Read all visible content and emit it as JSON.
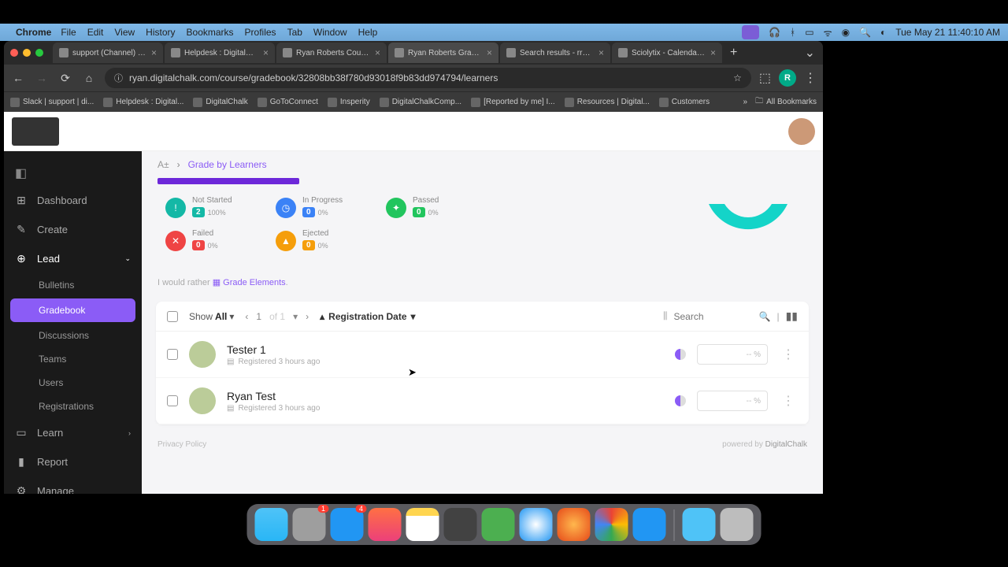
{
  "menubar": {
    "app": "Chrome",
    "items": [
      "File",
      "Edit",
      "View",
      "History",
      "Bookmarks",
      "Profiles",
      "Tab",
      "Window",
      "Help"
    ],
    "clock": "Tue May 21  11:40:10 AM"
  },
  "tabs": [
    {
      "title": "support (Channel) - di..."
    },
    {
      "title": "Helpdesk : DigitalChalk"
    },
    {
      "title": "Ryan Roberts Courses"
    },
    {
      "title": "Ryan Roberts Gradebo...",
      "active": true
    },
    {
      "title": "Search results - rrober..."
    },
    {
      "title": "Sciolytix - Calendar - W..."
    }
  ],
  "url": "ryan.digitalchalk.com/course/gradebook/32808bb38f780d93018f9b83dd974794/learners",
  "avatar_letter": "R",
  "bookmarks": [
    "Slack | support | di...",
    "Helpdesk : Digital...",
    "DigitalChalk",
    "GoToConnect",
    "Insperity",
    "DigitalChalkComp...",
    "[Reported by me] I...",
    "Resources | Digital...",
    "Customers"
  ],
  "bm_all": "All Bookmarks",
  "sidebar": {
    "items": [
      {
        "label": "Dashboard",
        "icon": "⊞"
      },
      {
        "label": "Create",
        "icon": "✎"
      },
      {
        "label": "Lead",
        "icon": "⊕",
        "expanded": true
      },
      {
        "label": "Learn",
        "icon": "▭"
      },
      {
        "label": "Report",
        "icon": "▮"
      },
      {
        "label": "Manage",
        "icon": "⚙"
      }
    ],
    "sub": [
      {
        "label": "Bulletins"
      },
      {
        "label": "Gradebook",
        "active": true
      },
      {
        "label": "Discussions"
      },
      {
        "label": "Teams"
      },
      {
        "label": "Users"
      },
      {
        "label": "Registrations"
      }
    ]
  },
  "breadcrumb": {
    "link": "Grade by Learners"
  },
  "stats": [
    {
      "label": "Not Started",
      "count": "2",
      "pct": "100%",
      "badge_bg": "#14b8a6",
      "icon_bg": "#14b8a6",
      "icon": "!"
    },
    {
      "label": "In Progress",
      "count": "0",
      "pct": "0%",
      "badge_bg": "#3b82f6",
      "icon_bg": "#3b82f6",
      "icon": "◷"
    },
    {
      "label": "Passed",
      "count": "0",
      "pct": "0%",
      "badge_bg": "#22c55e",
      "icon_bg": "#22c55e",
      "icon": "✦"
    },
    {
      "label": "Failed",
      "count": "0",
      "pct": "0%",
      "badge_bg": "#ef4444",
      "icon_bg": "#ef4444",
      "icon": "✕"
    },
    {
      "label": "Ejected",
      "count": "0",
      "pct": "0%",
      "badge_bg": "#f59e0b",
      "icon_bg": "#f59e0b",
      "icon": "▲"
    }
  ],
  "hint": {
    "prefix": "I would rather ",
    "link": "Grade Elements"
  },
  "toolbar": {
    "show": "Show",
    "all": "All",
    "page": "1",
    "of": "of 1",
    "sort": "Registration Date",
    "search_ph": "Search"
  },
  "rows": [
    {
      "name": "Tester 1",
      "meta": "Registered 3 hours ago",
      "score": "-- %"
    },
    {
      "name": "Ryan Test",
      "meta": "Registered 3 hours ago",
      "score": "-- %"
    }
  ],
  "footer": {
    "left": "Privacy Policy",
    "right_prefix": "powered by ",
    "right_link": "DigitalChalk"
  },
  "dock": {
    "badges": {
      "settings": "1",
      "appstore": "4"
    }
  },
  "chart_data": {
    "type": "pie",
    "title": "",
    "series": [
      {
        "name": "Not Started",
        "value": 100,
        "color": "#14b8a6"
      },
      {
        "name": "In Progress",
        "value": 0,
        "color": "#3b82f6"
      },
      {
        "name": "Passed",
        "value": 0,
        "color": "#22c55e"
      },
      {
        "name": "Failed",
        "value": 0,
        "color": "#ef4444"
      },
      {
        "name": "Ejected",
        "value": 0,
        "color": "#f59e0b"
      }
    ]
  }
}
